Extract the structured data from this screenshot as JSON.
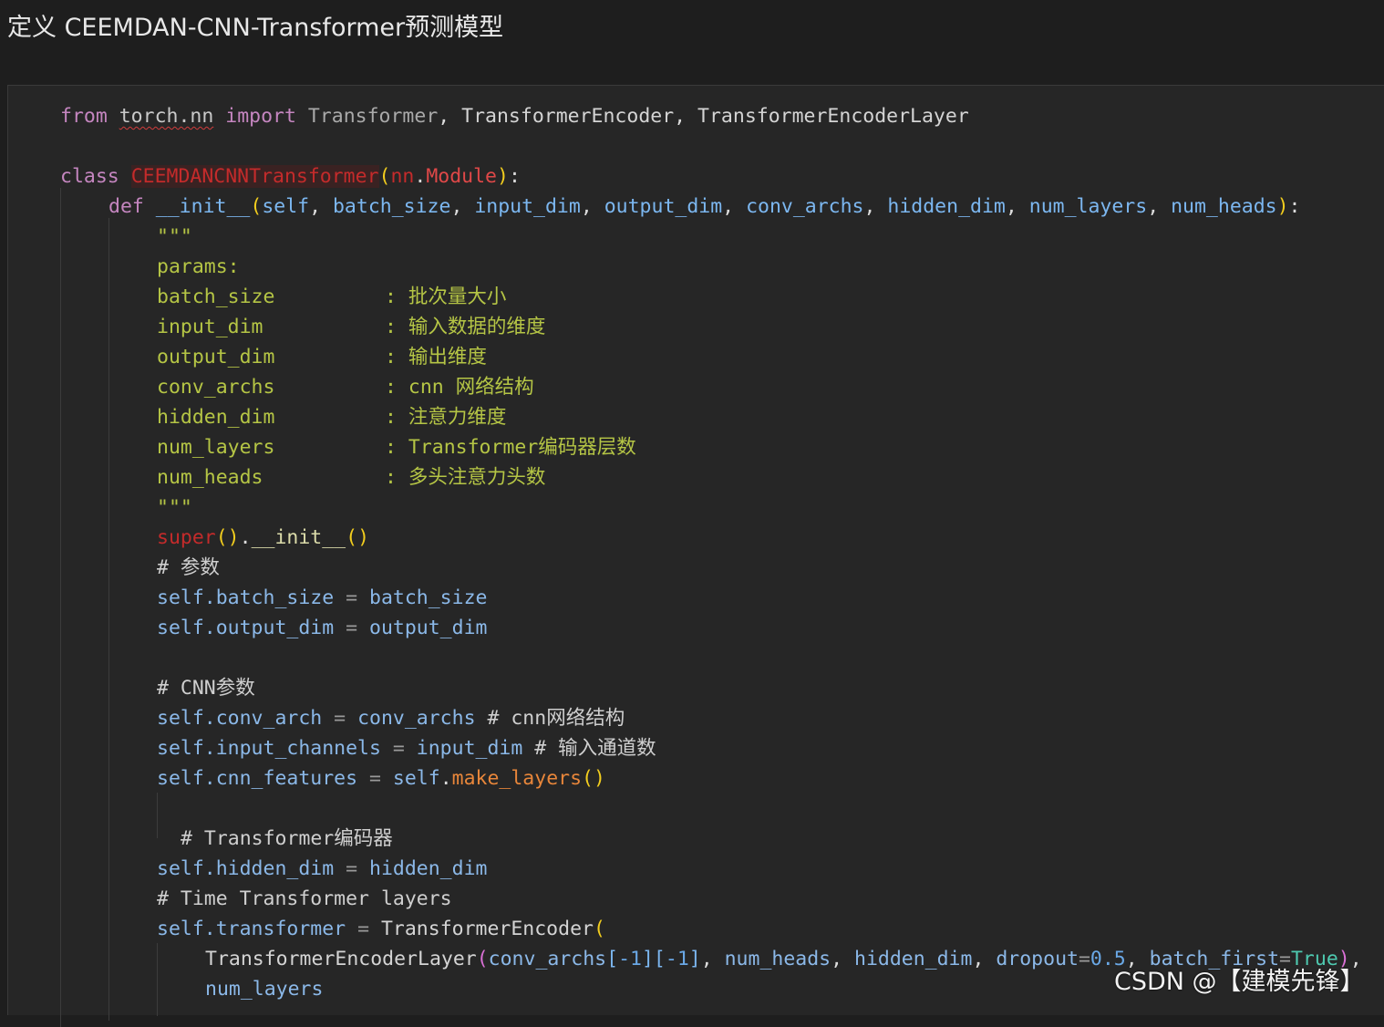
{
  "title": "定义 CEEMDAN-CNN-Transformer预测模型",
  "watermark": "CSDN @【建模先锋】",
  "code": {
    "l1": {
      "from": "from",
      "mod": "torch.nn",
      "import": "import",
      "a": "Transformer",
      "c1": ", ",
      "b": "TransformerEncoder",
      "c2": ", ",
      "c": "TransformerEncoderLayer"
    },
    "l2": {
      "class": "class",
      "name": "CEEMDANCNNTransformer",
      "p1": "(",
      "nn": "nn",
      "dot": ".",
      "module": "Module",
      "p2": ")",
      "colon": ":"
    },
    "l3": {
      "def": "def",
      "fn": "__init__",
      "p1": "(",
      "args": [
        "self",
        "batch_size",
        "input_dim",
        "output_dim",
        "conv_archs",
        "hidden_dim",
        "num_layers",
        "num_heads"
      ],
      "sep": ", ",
      "p2": ")",
      "colon": ":"
    },
    "doc_open": "\"\"\"",
    "doc_params": "params:",
    "doc_rows": [
      {
        "k": "batch_size",
        "v": ": 批次量大小"
      },
      {
        "k": "input_dim",
        "v": ": 输入数据的维度"
      },
      {
        "k": "output_dim",
        "v": ": 输出维度"
      },
      {
        "k": "conv_archs",
        "v": ": cnn 网络结构"
      },
      {
        "k": "hidden_dim",
        "v": ": 注意力维度"
      },
      {
        "k": "num_layers",
        "v": ": Transformer编码器层数"
      },
      {
        "k": "num_heads",
        "v": ": 多头注意力头数"
      }
    ],
    "doc_close": "\"\"\"",
    "super": {
      "kw": "super",
      "p": "()",
      "dot": ".",
      "fn": "__init__",
      "p2": "()"
    },
    "c_params": "# 参数",
    "a1": {
      "self": "self",
      "attr": ".batch_size",
      "eq": " = ",
      "val": "batch_size"
    },
    "a2": {
      "self": "self",
      "attr": ".output_dim",
      "eq": " = ",
      "val": "output_dim"
    },
    "c_cnn": "# CNN参数",
    "a3": {
      "self": "self",
      "attr": ".conv_arch",
      "eq": " = ",
      "val": "conv_archs",
      "cmt": " # cnn网络结构"
    },
    "a4": {
      "self": "self",
      "attr": ".input_channels",
      "eq": " = ",
      "val": "input_dim",
      "cmt": " # 输入通道数"
    },
    "a5": {
      "self": "self",
      "attr": ".cnn_features",
      "eq": " = ",
      "s2": "self",
      "dot": ".",
      "fn": "make_layers",
      "p": "()"
    },
    "c_enc": "# Transformer编码器",
    "a6": {
      "self": "self",
      "attr": ".hidden_dim",
      "eq": " = ",
      "val": "hidden_dim"
    },
    "c_time": "# Time Transformer layers",
    "a7": {
      "self": "self",
      "attr": ".transformer",
      "eq": " = ",
      "cls": "TransformerEncoder",
      "p": "("
    },
    "a8": {
      "cls": "TransformerEncoderLayer",
      "p": "(",
      "arr": "conv_archs",
      "b1": "[",
      "n1": "-1",
      "b2": "]",
      "b3": "[",
      "n2": "-1",
      "b4": "]",
      "c": ", ",
      "h": "num_heads",
      "c2": ", ",
      "hd": "hidden_dim",
      "c3": ", ",
      "dk": "dropout",
      "eq": "=",
      "dv": "0.5",
      "c4": ", ",
      "bk": "batch_first",
      "eq2": "=",
      "bv": "True",
      "pe": ")",
      "tail": ","
    },
    "a9": {
      "val": "num_layers"
    }
  }
}
